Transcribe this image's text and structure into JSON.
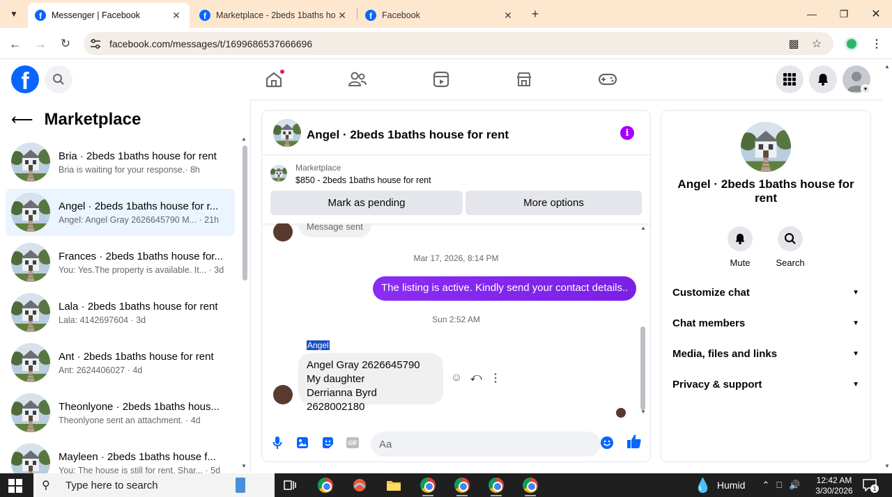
{
  "browser": {
    "tabs": [
      {
        "title": "Messenger | Facebook",
        "active": true
      },
      {
        "title": "Marketplace - 2beds 1baths ho",
        "active": false
      },
      {
        "title": "Facebook",
        "active": false
      }
    ],
    "url": "facebook.com/messages/t/1699686537666696"
  },
  "left": {
    "title": "Marketplace",
    "conversations": [
      {
        "name": "Bria · 2beds 1baths house for rent",
        "preview": "Bria is waiting for your response.· 8h",
        "selected": false
      },
      {
        "name": "Angel · 2beds 1baths house for r...",
        "preview": "Angel: Angel Gray 2626645790 M...  · 21h",
        "selected": true
      },
      {
        "name": "Frances · 2beds 1baths house for...",
        "preview": "You: Yes.The property is available. It...  · 3d",
        "selected": false
      },
      {
        "name": "Lala · 2beds 1baths house for rent",
        "preview": "Lala: 4142697604 · 3d",
        "selected": false
      },
      {
        "name": "Ant · 2beds 1baths house for rent",
        "preview": "Ant: 2624406027 · 4d",
        "selected": false
      },
      {
        "name": "Theonlyone · 2beds 1baths hous...",
        "preview": "Theonlyone sent an attachment. · 4d",
        "selected": false
      },
      {
        "name": "Mayleen · 2beds 1baths house f...",
        "preview": "You: The house is still for rent. Shar...  · 5d",
        "selected": false
      }
    ]
  },
  "chat": {
    "title": "Angel · 2beds 1baths house for rent",
    "marketplace_label": "Marketplace",
    "listing": "$850 - 2beds 1baths house for rent",
    "mark_pending": "Mark as pending",
    "more_options": "More options",
    "prev_partial": "Message sent",
    "ts1": "Mar 17, 2026, 8:14 PM",
    "sent_msg": "The listing is active. Kindly send your contact details..",
    "ts2": "Sun 2:52 AM",
    "sender": "Angel",
    "received_lines": [
      "Angel Gray 2626645790",
      "My daughter",
      "Derrianna Byrd 2628002180"
    ],
    "composer_placeholder": "Aa",
    "gif_label": "GIF"
  },
  "right": {
    "name": "Angel · 2beds 1baths house for rent",
    "actions": [
      "Mute",
      "Search"
    ],
    "sections": [
      "Customize chat",
      "Chat members",
      "Media, files and links",
      "Privacy & support"
    ]
  },
  "taskbar": {
    "search_placeholder": "Type here to search",
    "weather": "Humid",
    "time": "12:42 AM",
    "date": "3/30/2026",
    "notification_count": "1"
  },
  "colors": {
    "fb_blue": "#0866ff",
    "message_purple": "#8b2cf5",
    "selected_row": "#ebf5ff",
    "tab_strip": "#fde8cf"
  }
}
